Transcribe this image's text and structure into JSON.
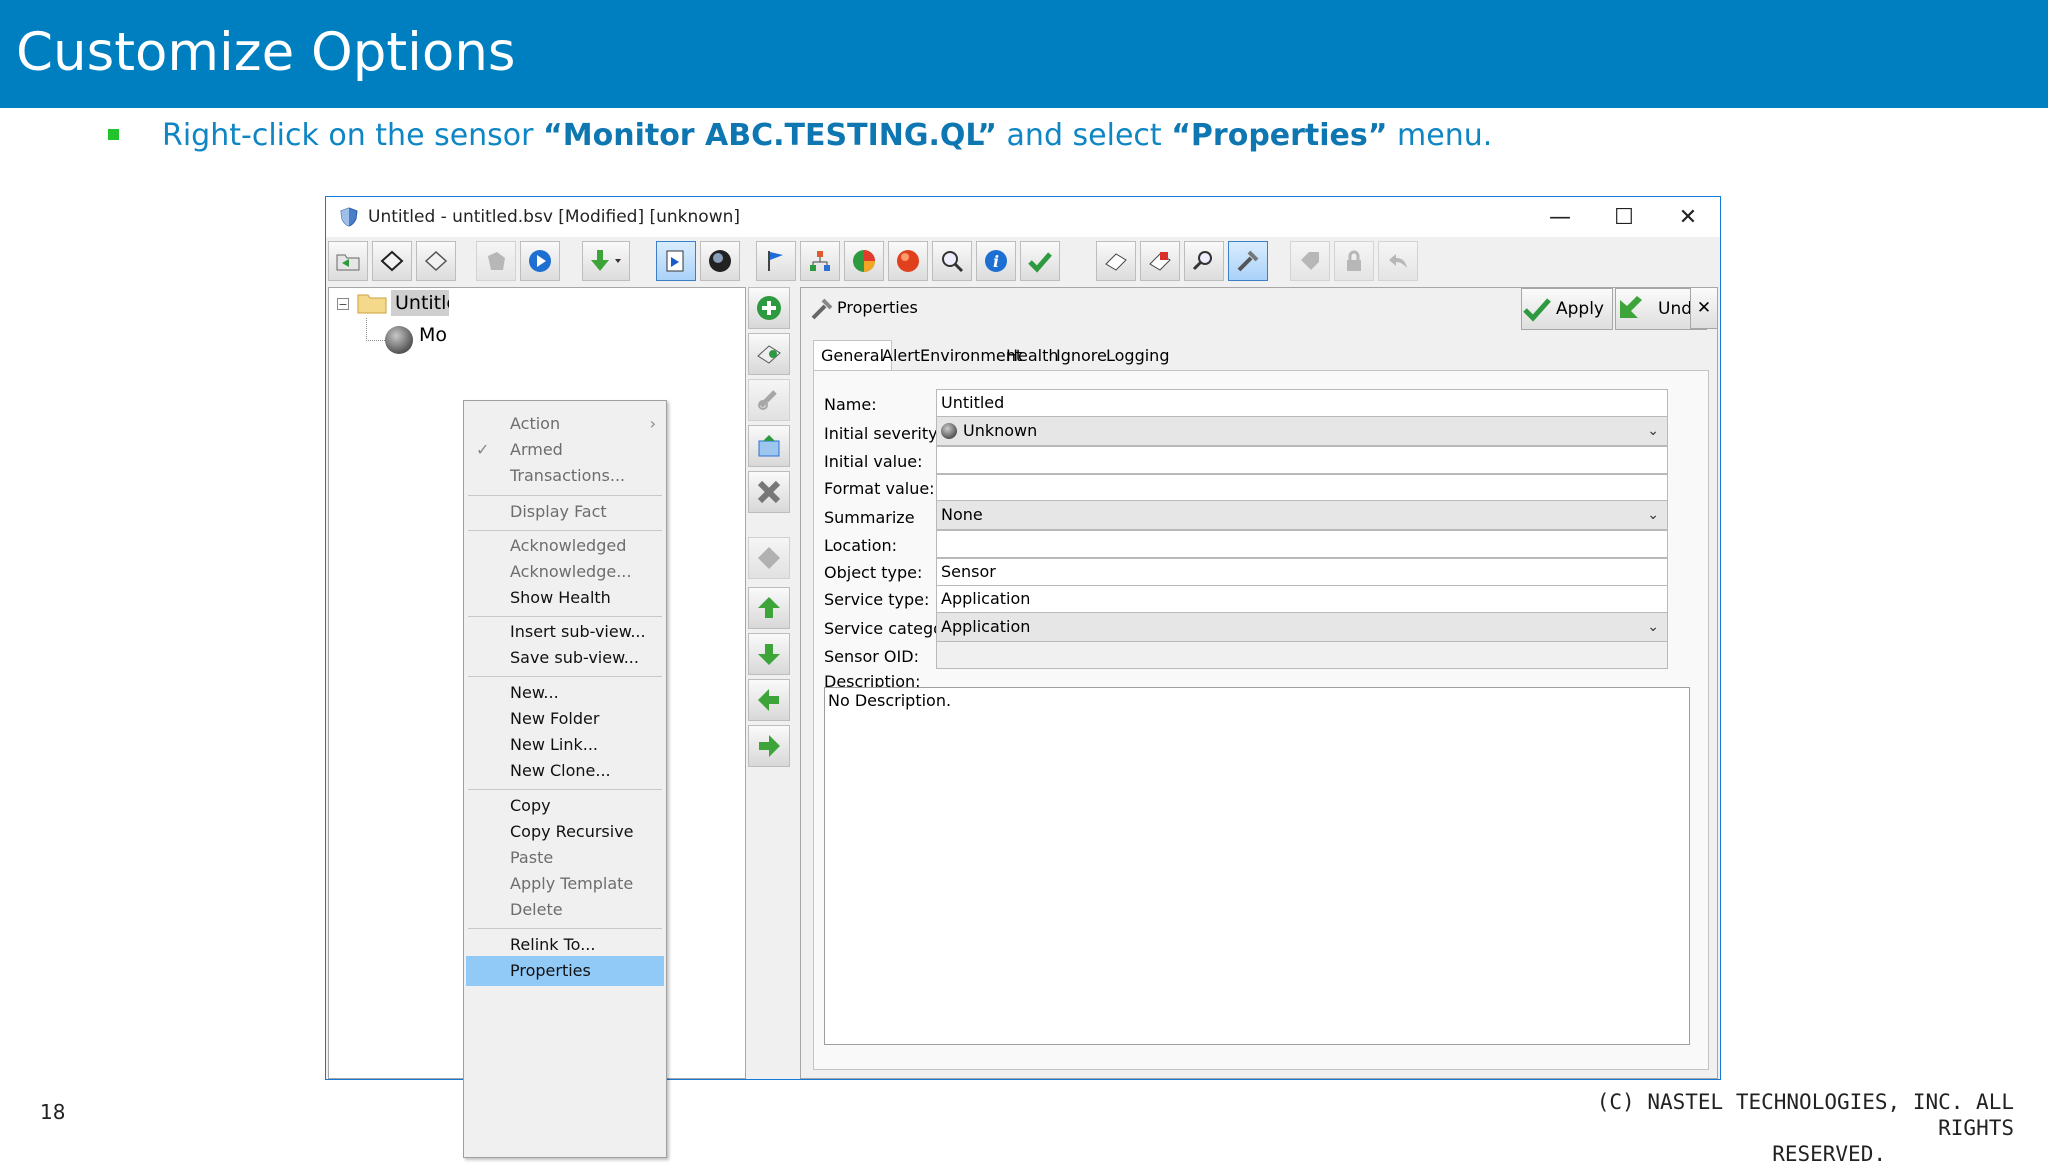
{
  "slide": {
    "title": "Customize Options",
    "instruction": {
      "p1": "Right-click on the sensor ",
      "b1": "“Monitor ABC.TESTING.QL”",
      "p2": " and select ",
      "b2": "“Properties”",
      "p3": " menu."
    },
    "page_number": "18",
    "copyright_line1": "(C) NASTEL TECHNOLOGIES, INC. ALL RIGHTS",
    "copyright_line2": "RESERVED."
  },
  "window": {
    "title": "Untitled - untitled.bsv [Modified] [unknown]",
    "minimize": "—",
    "maximize": "☐",
    "close": "✕"
  },
  "toolbar": {
    "icons": [
      "open-icon",
      "save-icon",
      "save-as-icon",
      "unlink-icon",
      "play-icon",
      "download-icon",
      "select-icon",
      "globe-icon",
      "flag-icon",
      "tree-icon",
      "pie-icon",
      "alert-ball-icon",
      "search-icon",
      "info-icon",
      "checkmark-icon",
      "book-icon",
      "calendar-icon",
      "find-icon",
      "tools-icon",
      "tag-icon",
      "lock-icon",
      "undo-arrow-icon"
    ]
  },
  "tree": {
    "root_label": "Untitled",
    "child_label": "Monitor ABC.TESTING.QL",
    "expander": "−"
  },
  "context_menu": {
    "items": [
      {
        "label": "Action",
        "disabled": true
      },
      {
        "label": "Armed",
        "disabled": true
      },
      {
        "label": "Transactions...",
        "disabled": true
      },
      {
        "label": "Display Fact",
        "disabled": true
      },
      {
        "label": "Acknowledged",
        "disabled": true
      },
      {
        "label": "Acknowledge...",
        "disabled": true
      },
      {
        "label": "Show Health",
        "disabled": false
      },
      {
        "label": "Insert sub-view...",
        "disabled": false
      },
      {
        "label": "Save sub-view...",
        "disabled": false
      },
      {
        "label": "New...",
        "disabled": false
      },
      {
        "label": "New Folder",
        "disabled": false
      },
      {
        "label": "New Link...",
        "disabled": false
      },
      {
        "label": "New Clone...",
        "disabled": false
      },
      {
        "label": "Copy",
        "disabled": false
      },
      {
        "label": "Copy Recursive",
        "disabled": false
      },
      {
        "label": "Paste",
        "disabled": true
      },
      {
        "label": "Apply Template",
        "disabled": true
      },
      {
        "label": "Delete",
        "disabled": true
      },
      {
        "label": "Relink To...",
        "disabled": false
      },
      {
        "label": "Properties",
        "disabled": false,
        "selected": true
      }
    ],
    "submenu_arrow": "›",
    "check_mark": "✓"
  },
  "side_buttons": [
    "add-icon",
    "link-add-icon",
    "chain-icon",
    "window-icon",
    "delete-x-icon",
    "diamond-icon",
    "arrow-up-icon",
    "arrow-down-icon",
    "arrow-left-icon",
    "arrow-right-icon"
  ],
  "properties": {
    "title": "Properties",
    "apply_label": "Apply",
    "undo_label": "Undo",
    "close_label": "✕",
    "tabs": [
      "General",
      "Alert",
      "Environment",
      "Health",
      "Ignore",
      "Logging"
    ],
    "fields": {
      "name_label": "Name:",
      "name_value": "Untitled",
      "severity_label": "Initial severity:",
      "severity_value": "Unknown",
      "initial_value_label": "Initial value:",
      "initial_value": "",
      "format_label": "Format value:",
      "format_value": "",
      "summarize_label": "Summarize",
      "summarize_value": "None",
      "location_label": "Location:",
      "location_value": "",
      "object_type_label": "Object type:",
      "object_type_value": "Sensor",
      "service_type_label": "Service type:",
      "service_type_value": "Application",
      "service_category_label": "Service category:",
      "service_category_value": "Application",
      "sensor_oid_label": "Sensor OID:",
      "sensor_oid_value": "",
      "description_label": "Description:",
      "description_value": "No Description."
    }
  },
  "colors": {
    "header_blue": "#007fc0",
    "menu_highlight": "#91c9f7",
    "window_border": "#1778d3",
    "bullet_green": "#22c32d"
  }
}
